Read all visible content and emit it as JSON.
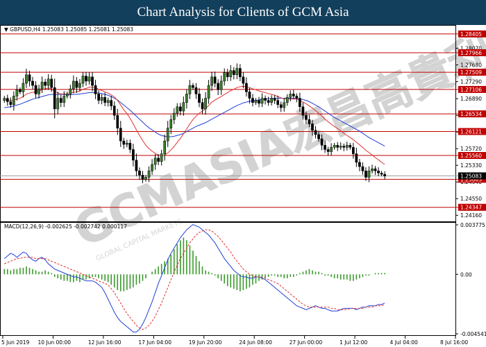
{
  "header": {
    "title": "Chart Analysis for Clients of GCM Asia"
  },
  "watermark": {
    "text": "GCMASIA宏昌高貴利",
    "subtext": "GLOBAL CAPITAL MARKETS"
  },
  "colors": {
    "bull": "#3a7d2c",
    "bear": "#000000",
    "ma_fast": "#e03030",
    "ma_slow": "#1f3fd6",
    "level": "#c00000",
    "macd_line": "#1f3fd6",
    "signal_line": "#e03030",
    "hist": "#3a9a2a",
    "header_bg": "#123f5c"
  },
  "chart_data": [
    {
      "type": "candlestick",
      "info": "▼ GBPUSD,H4  1.25083 1.25085 1.25081 1.25083",
      "ylim": [
        1.2405,
        1.2855
      ],
      "price_ticks": [
        "1.28070",
        "1.27680",
        "1.27290",
        "1.26890",
        "1.26500",
        "1.26110",
        "1.25720",
        "1.25330",
        "1.24940",
        "1.24550",
        "1.24160"
      ],
      "price_tick_values": [
        1.2807,
        1.2768,
        1.2729,
        1.2689,
        1.265,
        1.2611,
        1.2572,
        1.2533,
        1.2494,
        1.2455,
        1.2416
      ],
      "levels": [
        {
          "label": "1.28405",
          "value": 1.28405
        },
        {
          "label": "1.27966",
          "value": 1.27966
        },
        {
          "label": "1.27509",
          "value": 1.27509
        },
        {
          "label": "1.27106",
          "value": 1.27106
        },
        {
          "label": "1.26534",
          "value": 1.26534
        },
        {
          "label": "1.26121",
          "value": 1.26121
        },
        {
          "label": "1.25560",
          "value": 1.2556
        },
        {
          "label": "1.25003",
          "value": 1.25003
        },
        {
          "label": "1.24347",
          "value": 1.24347
        }
      ],
      "current_price": {
        "label": "1.25083",
        "value": 1.25083
      },
      "candles_close": [
        1.269,
        1.2682,
        1.2675,
        1.2695,
        1.271,
        1.2705,
        1.2725,
        1.2745,
        1.273,
        1.272,
        1.27,
        1.2712,
        1.2728,
        1.272,
        1.2735,
        1.2715,
        1.2665,
        1.269,
        1.268,
        1.2695,
        1.27,
        1.2712,
        1.273,
        1.2715,
        1.2725,
        1.2742,
        1.273,
        1.274,
        1.272,
        1.27,
        1.2685,
        1.2692,
        1.268,
        1.2685,
        1.2672,
        1.265,
        1.262,
        1.259,
        1.2582,
        1.2585,
        1.257,
        1.2545,
        1.252,
        1.251,
        1.25,
        1.2505,
        1.252,
        1.2535,
        1.255,
        1.2542,
        1.256,
        1.259,
        1.262,
        1.264,
        1.2655,
        1.267,
        1.266,
        1.268,
        1.27,
        1.272,
        1.2715,
        1.27,
        1.268,
        1.2665,
        1.269,
        1.272,
        1.274,
        1.2725,
        1.271,
        1.273,
        1.275,
        1.274,
        1.2755,
        1.2745,
        1.276,
        1.274,
        1.2725,
        1.2705,
        1.269,
        1.268,
        1.2685,
        1.2678,
        1.269,
        1.2685,
        1.268,
        1.269,
        1.2685,
        1.2675,
        1.2668,
        1.268,
        1.2692,
        1.27,
        1.2695,
        1.269,
        1.267,
        1.265,
        1.264,
        1.263,
        1.2615,
        1.2605,
        1.2595,
        1.258,
        1.257,
        1.2565,
        1.2575,
        1.258,
        1.2575,
        1.2578,
        1.2575,
        1.258,
        1.2575,
        1.256,
        1.254,
        1.253,
        1.252,
        1.2505,
        1.252,
        1.2525,
        1.252,
        1.2515,
        1.2512,
        1.2508
      ],
      "ma_fast": [
        1.2686,
        1.2685,
        1.2685,
        1.2686,
        1.2688,
        1.269,
        1.2694,
        1.27,
        1.2702,
        1.2704,
        1.2705,
        1.2707,
        1.271,
        1.2712,
        1.2714,
        1.2712,
        1.2706,
        1.2703,
        1.27,
        1.27,
        1.27,
        1.2701,
        1.2704,
        1.2705,
        1.2707,
        1.2711,
        1.2713,
        1.2716,
        1.2716,
        1.2715,
        1.2711,
        1.2708,
        1.2705,
        1.2702,
        1.2698,
        1.2693,
        1.2685,
        1.2674,
        1.2663,
        1.2654,
        1.2643,
        1.263,
        1.2616,
        1.2603,
        1.2591,
        1.258,
        1.2572,
        1.2566,
        1.2561,
        1.2557,
        1.2555,
        1.2557,
        1.2562,
        1.2569,
        1.2577,
        1.2587,
        1.2596,
        1.2607,
        1.2618,
        1.263,
        1.264,
        1.2648,
        1.2655,
        1.266,
        1.2666,
        1.2673,
        1.2681,
        1.2686,
        1.269,
        1.2694,
        1.2699,
        1.2703,
        1.2708,
        1.2711,
        1.2715,
        1.2717,
        1.2718,
        1.2717,
        1.2715,
        1.2712,
        1.271,
        1.2707,
        1.2705,
        1.2703,
        1.2701,
        1.2699,
        1.2697,
        1.2694,
        1.2691,
        1.2689,
        1.2688,
        1.2688,
        1.2688,
        1.2688,
        1.2685,
        1.2681,
        1.2677,
        1.2672,
        1.2667,
        1.2661,
        1.2655,
        1.2648,
        1.2641,
        1.2635,
        1.2629,
        1.2624,
        1.2619,
        1.2614,
        1.2608,
        1.2603,
        1.2598,
        1.2593,
        1.2587,
        1.2581,
        1.2575,
        1.2568,
        1.2563,
        1.2557,
        1.2551,
        1.2546,
        1.254,
        1.2535
      ],
      "ma_slow": [
        1.2668,
        1.2669,
        1.267,
        1.2672,
        1.2674,
        1.2676,
        1.2679,
        1.2682,
        1.2685,
        1.2688,
        1.269,
        1.2692,
        1.2694,
        1.2696,
        1.2698,
        1.2699,
        1.2699,
        1.2699,
        1.2699,
        1.2699,
        1.2698,
        1.2698,
        1.2699,
        1.2699,
        1.27,
        1.2701,
        1.2702,
        1.2703,
        1.2703,
        1.2703,
        1.2702,
        1.2701,
        1.2699,
        1.2697,
        1.2694,
        1.269,
        1.2686,
        1.268,
        1.2674,
        1.2668,
        1.2662,
        1.2655,
        1.2648,
        1.2641,
        1.2634,
        1.2627,
        1.2621,
        1.2616,
        1.2611,
        1.2606,
        1.2603,
        1.2601,
        1.26,
        1.26,
        1.2601,
        1.2603,
        1.2605,
        1.2608,
        1.2612,
        1.2616,
        1.262,
        1.2624,
        1.2627,
        1.263,
        1.2633,
        1.2637,
        1.2641,
        1.2645,
        1.2649,
        1.2653,
        1.2657,
        1.2661,
        1.2665,
        1.2669,
        1.2673,
        1.2676,
        1.2679,
        1.2681,
        1.2683,
        1.2684,
        1.2685,
        1.2686,
        1.2687,
        1.2688,
        1.2689,
        1.269,
        1.269,
        1.269,
        1.269,
        1.269,
        1.269,
        1.269,
        1.269,
        1.269,
        1.2689,
        1.2687,
        1.2685,
        1.2682,
        1.2678,
        1.2674,
        1.267,
        1.2665,
        1.266,
        1.2655,
        1.265,
        1.2645,
        1.2641,
        1.2637,
        1.2633,
        1.2629,
        1.2625,
        1.2621,
        1.2617,
        1.2613,
        1.2608,
        1.2603,
        1.2598,
        1.2594,
        1.259,
        1.2586,
        1.2582,
        1.2578
      ]
    },
    {
      "type": "macd",
      "title": "MACD(12,26,9) -0.002625 -0.002742 0.000117",
      "ylim": [
        -0.004541,
        0.003775
      ],
      "ticks": [
        "0.003775",
        "0.00",
        "-0.004541"
      ],
      "tick_values": [
        0.003775,
        0,
        -0.004541
      ],
      "histogram": [
        0.0004,
        0.0004,
        0.0003,
        0.0004,
        0.0004,
        0.0005,
        0.0005,
        0.0006,
        0.0005,
        0.0004,
        0.0003,
        0.0002,
        0.0002,
        0.0003,
        0.0002,
        0.0001,
        -0.0002,
        -0.0003,
        -0.0004,
        -0.0005,
        -0.0005,
        -0.0006,
        -0.0006,
        -0.0005,
        -0.0006,
        -0.0004,
        -0.0004,
        -0.0003,
        -0.0002,
        -0.0002,
        -0.0003,
        -0.0004,
        -0.0005,
        -0.0006,
        -0.0008,
        -0.001,
        -0.0012,
        -0.0013,
        -0.0013,
        -0.0012,
        -0.0011,
        -0.001,
        -0.0008,
        -0.0007,
        -0.0005,
        -0.0003,
        0.0,
        0.0002,
        0.0004,
        0.0006,
        0.0008,
        0.001,
        0.0012,
        0.0015,
        0.0019,
        0.0023,
        0.0026,
        0.0028,
        0.0026,
        0.0022,
        0.0018,
        0.0014,
        0.001,
        0.0006,
        0.0003,
        0.0002,
        0.0001,
        -0.0001,
        -0.0003,
        -0.0005,
        -0.0007,
        -0.0009,
        -0.001,
        -0.0011,
        -0.0012,
        -0.0013,
        -0.0012,
        -0.0011,
        -0.001,
        -0.0008,
        -0.0007,
        -0.0005,
        -0.0004,
        -0.0003,
        -0.0002,
        -0.0001,
        -0.0001,
        -0.0002,
        -0.0002,
        -0.0003,
        -0.0003,
        -0.0002,
        -0.0002,
        -0.0001,
        0.0001,
        0.0002,
        0.0003,
        0.0004,
        0.0003,
        0.0002,
        0.0002,
        0.0001,
        -0.0001,
        -0.0001,
        -0.0002,
        -0.0003,
        -0.0003,
        -0.0004,
        -0.0004,
        -0.0004,
        -0.0005,
        -0.0005,
        -0.0004,
        -0.0003,
        -0.0002,
        -0.0001,
        -0.0001,
        0.0,
        0.0001,
        0.0001,
        0.0001,
        0.0001
      ],
      "macd": [
        0.0012,
        0.0014,
        0.0016,
        0.0015,
        0.0013,
        0.0015,
        0.0017,
        0.0016,
        0.0013,
        0.0011,
        0.001,
        0.0012,
        0.0013,
        0.0011,
        0.0008,
        0.0006,
        0.0004,
        0.0003,
        0.0002,
        0.0001,
        0.0,
        -0.0001,
        -0.0002,
        -0.0002,
        -0.0003,
        -0.0004,
        -0.0005,
        -0.0005,
        -0.0005,
        -0.0006,
        -0.0008,
        -0.001,
        -0.0014,
        -0.0019,
        -0.0024,
        -0.0029,
        -0.0033,
        -0.0036,
        -0.0038,
        -0.004,
        -0.0042,
        -0.0044,
        -0.0044,
        -0.0042,
        -0.0038,
        -0.0033,
        -0.0027,
        -0.0021,
        -0.0014,
        -0.0007,
        -0.0001,
        0.0005,
        0.0011,
        0.0016,
        0.002,
        0.0024,
        0.0028,
        0.0031,
        0.0034,
        0.0036,
        0.0038,
        0.0037,
        0.0036,
        0.0034,
        0.0032,
        0.003,
        0.0027,
        0.0024,
        0.002,
        0.0016,
        0.0012,
        0.0009,
        0.0006,
        0.0003,
        0.0001,
        -0.0001,
        -0.0002,
        -0.0002,
        -0.0003,
        -0.0003,
        -0.0002,
        -0.0002,
        -0.0003,
        -0.0004,
        -0.0006,
        -0.0008,
        -0.001,
        -0.0012,
        -0.0014,
        -0.0016,
        -0.0018,
        -0.002,
        -0.0022,
        -0.0024,
        -0.0025,
        -0.0026,
        -0.0027,
        -0.0026,
        -0.0025,
        -0.0024,
        -0.0025,
        -0.0026,
        -0.0026,
        -0.0027,
        -0.0028,
        -0.0028,
        -0.0028,
        -0.0027,
        -0.0026,
        -0.0026,
        -0.0026,
        -0.0026,
        -0.0027,
        -0.0026,
        -0.0025,
        -0.0025,
        -0.0024,
        -0.0024,
        -0.0024,
        -0.0023,
        -0.0023,
        -0.0022
      ],
      "signal": [
        0.0008,
        0.0009,
        0.001,
        0.0011,
        0.0012,
        0.0012,
        0.0013,
        0.0013,
        0.0013,
        0.0013,
        0.0012,
        0.0012,
        0.0012,
        0.0012,
        0.0011,
        0.001,
        0.0009,
        0.0008,
        0.0007,
        0.0006,
        0.0005,
        0.0004,
        0.0003,
        0.0002,
        0.0001,
        0.0,
        -0.0001,
        -0.0002,
        -0.0003,
        -0.0004,
        -0.0005,
        -0.0006,
        -0.0007,
        -0.0008,
        -0.0011,
        -0.0014,
        -0.0018,
        -0.0022,
        -0.0026,
        -0.003,
        -0.0033,
        -0.0036,
        -0.0039,
        -0.0041,
        -0.0042,
        -0.0041,
        -0.0039,
        -0.0036,
        -0.0032,
        -0.0027,
        -0.0022,
        -0.0016,
        -0.001,
        -0.0004,
        0.0002,
        0.0007,
        0.0012,
        0.0016,
        0.002,
        0.0024,
        0.0027,
        0.003,
        0.0032,
        0.0033,
        0.0034,
        0.0034,
        0.0033,
        0.0031,
        0.0029,
        0.0026,
        0.0023,
        0.002,
        0.0017,
        0.0013,
        0.001,
        0.0007,
        0.0004,
        0.0002,
        0.0,
        -0.0001,
        -0.0002,
        -0.0002,
        -0.0002,
        -0.0003,
        -0.0004,
        -0.0005,
        -0.0006,
        -0.0007,
        -0.0009,
        -0.0011,
        -0.0013,
        -0.0015,
        -0.0017,
        -0.0019,
        -0.0021,
        -0.0023,
        -0.0024,
        -0.0025,
        -0.0025,
        -0.0025,
        -0.0025,
        -0.0025,
        -0.0025,
        -0.0025,
        -0.0026,
        -0.0026,
        -0.0027,
        -0.0027,
        -0.0027,
        -0.0027,
        -0.0026,
        -0.0026,
        -0.0026,
        -0.0026,
        -0.0026,
        -0.0025,
        -0.0025,
        -0.0025,
        -0.0024,
        -0.0024,
        -0.0024,
        -0.0023
      ]
    }
  ],
  "x_axis": {
    "labels": [
      "5 Jun 2019",
      "10 Jun 00:00",
      "12 Jun 16:00",
      "17 Jun 04:00",
      "19 Jun 20:00",
      "24 Jun 08:00",
      "27 Jun 00:00",
      "1 Jul 12:00",
      "4 Jul 04:00",
      "8 Jul 16:00"
    ],
    "label_index": [
      0,
      16,
      32,
      48,
      64,
      80,
      96,
      112,
      128,
      144
    ]
  }
}
